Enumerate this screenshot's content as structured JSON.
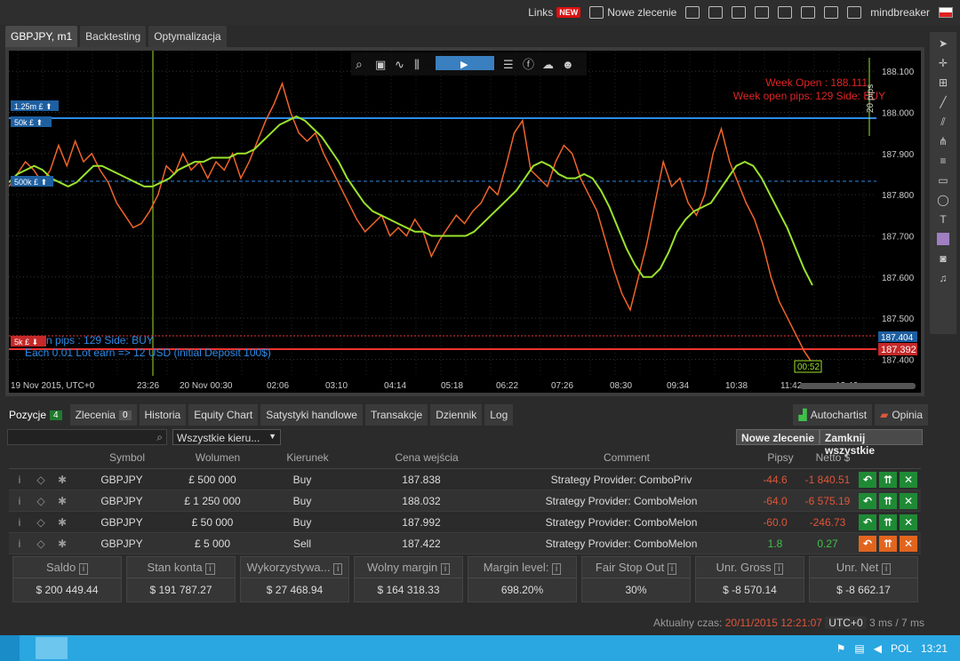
{
  "topbar": {
    "links": "Links",
    "links_badge": "NEW",
    "new_order": "Nowe zlecenie",
    "user": "mindbreaker"
  },
  "chart_tabs": [
    "GBPJPY, m1",
    "Backtesting",
    "Optymalizacja"
  ],
  "chart": {
    "week_open_label": "Week Open : 188.111",
    "week_open_pips": "Week open pips: 129 Side: BUY",
    "open_pips_label": "open pips : 129 Side: BUY",
    "lot_label": "Each 0.01 Lot earn => 12 USD (initial Deposit 100$)",
    "range_label": "20 pips",
    "current_price": "187.392",
    "current_price2": "187.404",
    "time_label": "00:52",
    "tags": [
      "1.25m £ ⬆",
      "50k £ ⬆",
      "500k £ ⬆",
      "5k £ ⬇"
    ],
    "y_ticks": [
      "188.100",
      "188.000",
      "187.900",
      "187.800",
      "187.700",
      "187.600",
      "187.500",
      "187.400"
    ],
    "x_ticks": [
      "19 Nov 2015, UTC+0",
      "23:26",
      "20 Nov 00:30",
      "02:06",
      "03:10",
      "04:14",
      "05:18",
      "06:22",
      "07:26",
      "08:30",
      "09:34",
      "10:38",
      "11:42",
      "12:46"
    ]
  },
  "chart_data": {
    "type": "line",
    "ylim": [
      187.36,
      188.15
    ],
    "levels": {
      "week_open": 188.111,
      "blue_line": 188.0,
      "blue_dashed": 187.83,
      "red_line": 187.392
    },
    "series": [
      {
        "values": [
          187.82,
          187.85,
          187.88,
          187.86,
          187.83,
          187.86,
          187.92,
          187.87,
          187.93,
          187.88,
          187.9,
          187.86,
          187.83,
          187.78,
          187.75,
          187.72,
          187.73,
          187.76,
          187.8,
          187.87,
          187.85,
          187.9,
          187.86,
          187.88,
          187.84,
          187.88,
          187.86,
          187.9,
          187.84,
          187.88,
          187.93,
          187.98,
          188.02,
          188.07,
          188.0,
          187.95,
          187.93,
          187.95,
          187.9,
          187.86,
          187.82,
          187.78,
          187.74,
          187.71,
          187.73,
          187.75,
          187.7,
          187.72,
          187.7,
          187.74,
          187.71,
          187.65,
          187.69,
          187.72,
          187.75,
          187.73,
          187.76,
          187.78,
          187.82,
          187.8,
          187.87,
          187.95,
          187.98,
          187.86,
          187.84,
          187.82,
          187.88,
          187.92,
          187.9,
          187.84,
          187.8,
          187.76,
          187.69,
          187.62,
          187.56,
          187.52,
          187.6,
          187.68,
          187.78,
          187.88,
          187.82,
          187.84,
          187.78,
          187.75,
          187.8,
          187.9,
          187.96,
          187.88,
          187.83,
          187.78,
          187.74,
          187.68,
          187.6,
          187.54,
          187.5,
          187.46,
          187.42,
          187.39
        ]
      },
      {
        "values": [
          187.83,
          187.85,
          187.86,
          187.87,
          187.86,
          187.84,
          187.83,
          187.82,
          187.83,
          187.85,
          187.87,
          187.87,
          187.86,
          187.85,
          187.84,
          187.83,
          187.82,
          187.82,
          187.83,
          187.84,
          187.86,
          187.87,
          187.88,
          187.88,
          187.89,
          187.89,
          187.89,
          187.9,
          187.9,
          187.91,
          187.93,
          187.95,
          187.97,
          187.98,
          187.99,
          187.98,
          187.96,
          187.94,
          187.91,
          187.88,
          187.84,
          187.81,
          187.78,
          187.76,
          187.75,
          187.74,
          187.73,
          187.72,
          187.71,
          187.71,
          187.7,
          187.7,
          187.7,
          187.7,
          187.7,
          187.71,
          187.73,
          187.75,
          187.77,
          187.79,
          187.81,
          187.84,
          187.87,
          187.88,
          187.87,
          187.85,
          187.84,
          187.84,
          187.85,
          187.84,
          187.81,
          187.77,
          187.72,
          187.67,
          187.63,
          187.6,
          187.6,
          187.62,
          187.66,
          187.71,
          187.74,
          187.76,
          187.77,
          187.78,
          187.81,
          187.84,
          187.87,
          187.88,
          187.87,
          187.84,
          187.8,
          187.76,
          187.72,
          187.67,
          187.62,
          187.58
        ]
      }
    ]
  },
  "positions_tabs": [
    {
      "label": "Pozycje",
      "count": "4"
    },
    {
      "label": "Zlecenia",
      "count": "0"
    },
    {
      "label": "Historia"
    },
    {
      "label": "Equity Chart"
    },
    {
      "label": "Satystyki handlowe"
    },
    {
      "label": "Transakcje"
    },
    {
      "label": "Dziennik"
    },
    {
      "label": "Log"
    }
  ],
  "right_tabs": [
    "Autochartist",
    "Opinia"
  ],
  "filter": {
    "direction": "Wszystkie kieru...",
    "new_order": "Nowe zlecenie",
    "close_all": "Zamknij wszystkie"
  },
  "table": {
    "headers": [
      "Symbol",
      "Wolumen",
      "Kierunek",
      "Cena wejścia",
      "Comment",
      "Pipsy",
      "Netto $"
    ],
    "rows": [
      {
        "symbol": "GBPJPY",
        "volume": "£ 500 000",
        "dir": "Buy",
        "price": "187.838",
        "comment": "Strategy Provider: ComboPriv",
        "pips": "-44.6",
        "net": "-1 840.51"
      },
      {
        "symbol": "GBPJPY",
        "volume": "£ 1 250 000",
        "dir": "Buy",
        "price": "188.032",
        "comment": "Strategy Provider: ComboMelon",
        "pips": "-64.0",
        "net": "-6 575.19"
      },
      {
        "symbol": "GBPJPY",
        "volume": "£ 50 000",
        "dir": "Buy",
        "price": "187.992",
        "comment": "Strategy Provider: ComboMelon",
        "pips": "-60.0",
        "net": "-246.73"
      },
      {
        "symbol": "GBPJPY",
        "volume": "£ 5 000",
        "dir": "Sell",
        "price": "187.422",
        "comment": "Strategy Provider: ComboMelon",
        "pips": "1.8",
        "net": "0.27"
      }
    ]
  },
  "summary": [
    {
      "label": "Saldo",
      "value": "$ 200 449.44"
    },
    {
      "label": "Stan konta",
      "value": "$ 191 787.27"
    },
    {
      "label": "Wykorzystywa...",
      "value": "$ 27 468.94"
    },
    {
      "label": "Wolny margin",
      "value": "$ 164 318.33"
    },
    {
      "label": "Margin level:",
      "value": "698.20%"
    },
    {
      "label": "Fair Stop Out",
      "value": "30%"
    },
    {
      "label": "Unr. Gross",
      "value": "$ -8 570.14"
    },
    {
      "label": "Unr. Net",
      "value": "$ -8 662.17"
    }
  ],
  "status": {
    "label": "Aktualny czas:",
    "time": "20/11/2015 12:21:07",
    "tz": "UTC+0",
    "ping": "3 ms / 7 ms"
  },
  "taskbar": {
    "lang": "POL",
    "clock": "13:21"
  },
  "colors": {
    "accent_green": "#1f8a35",
    "red": "#e0553a",
    "price_line": "#f0642a",
    "ma_line": "#9be22d"
  }
}
